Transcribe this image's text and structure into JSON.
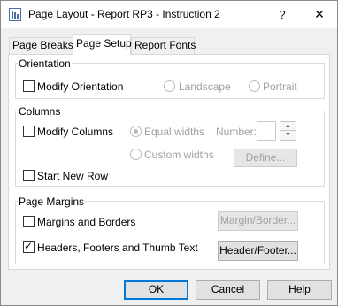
{
  "window": {
    "title": "Page Layout - Report RP3 - Instruction 2",
    "help_glyph": "?",
    "close_glyph": "✕"
  },
  "tabs": [
    {
      "label": "Page Breaks",
      "active": false
    },
    {
      "label": "Page Setup",
      "active": true
    },
    {
      "label": "Report Fonts",
      "active": false
    }
  ],
  "orientation": {
    "group_label": "Orientation",
    "modify_label": "Modify Orientation",
    "modify_checked": false,
    "landscape_label": "Landscape",
    "portrait_label": "Portrait"
  },
  "columns": {
    "group_label": "Columns",
    "modify_label": "Modify Columns",
    "modify_checked": false,
    "equal_widths_label": "Equal widths",
    "equal_widths_selected": true,
    "custom_widths_label": "Custom widths",
    "number_label": "Number:",
    "number_value": "",
    "define_label": "Define...",
    "start_new_row_label": "Start New Row",
    "start_new_row_checked": false
  },
  "margins": {
    "group_label": "Page Margins",
    "margins_borders_label": "Margins and Borders",
    "margins_borders_checked": false,
    "margin_border_button": "Margin/Border...",
    "headers_label": "Headers, Footers and Thumb Text",
    "headers_checked": true,
    "header_footer_button": "Header/Footer..."
  },
  "footer": {
    "ok": "OK",
    "cancel": "Cancel",
    "help": "Help"
  },
  "glyphs": {
    "check": "✓",
    "spin_up": "▲",
    "spin_down": "▼"
  },
  "colors": {
    "accent": "#0078d7",
    "disabled_text": "#a0a0a0"
  }
}
